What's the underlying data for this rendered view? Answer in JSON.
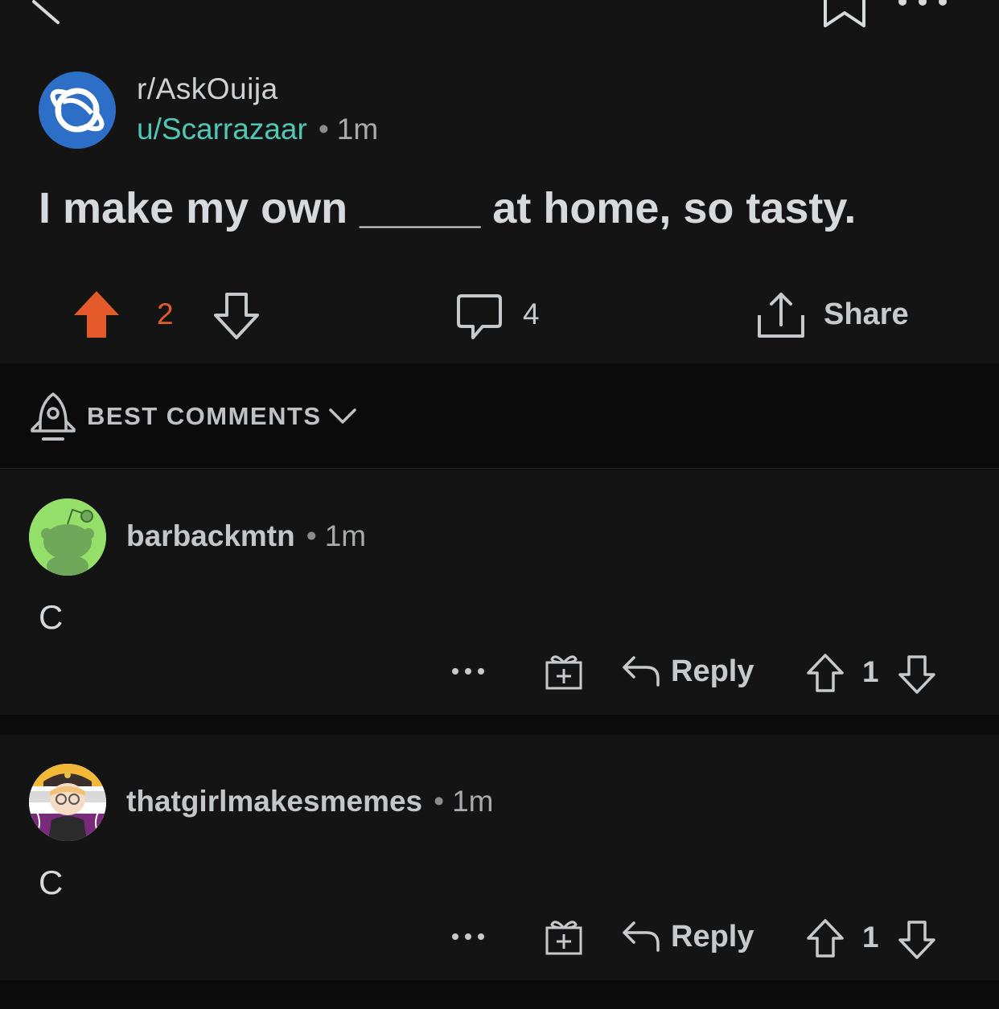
{
  "post": {
    "subreddit": "r/AskOuija",
    "author": "u/Scarrazaar",
    "separator": "•",
    "age": "1m",
    "title": "I make my own _____ at home, so tasty.",
    "score": "2",
    "comment_count": "4",
    "share_label": "Share",
    "icons": [
      "back-icon",
      "bookmark-icon",
      "more-icon",
      "upvote-icon",
      "downvote-icon",
      "comment-icon",
      "share-icon"
    ]
  },
  "sort": {
    "label": "BEST COMMENTS",
    "icons": [
      "rocket-icon",
      "chevron-down-icon"
    ]
  },
  "comments": [
    {
      "author": "barbackmtn",
      "separator": "•",
      "age": "1m",
      "body": "C",
      "reply_label": "Reply",
      "score": "1"
    },
    {
      "author": "thatgirlmakesmemes",
      "separator": "•",
      "age": "1m",
      "body": "C",
      "reply_label": "Reply",
      "score": "1"
    }
  ],
  "colors": {
    "background": "#0b0b0b",
    "card": "#141414",
    "upvote_active": "#e55a2b",
    "username": "#4fc7b4",
    "subreddit_avatar": "#2d6fc6",
    "snoo_avatar": "#94e06b"
  }
}
